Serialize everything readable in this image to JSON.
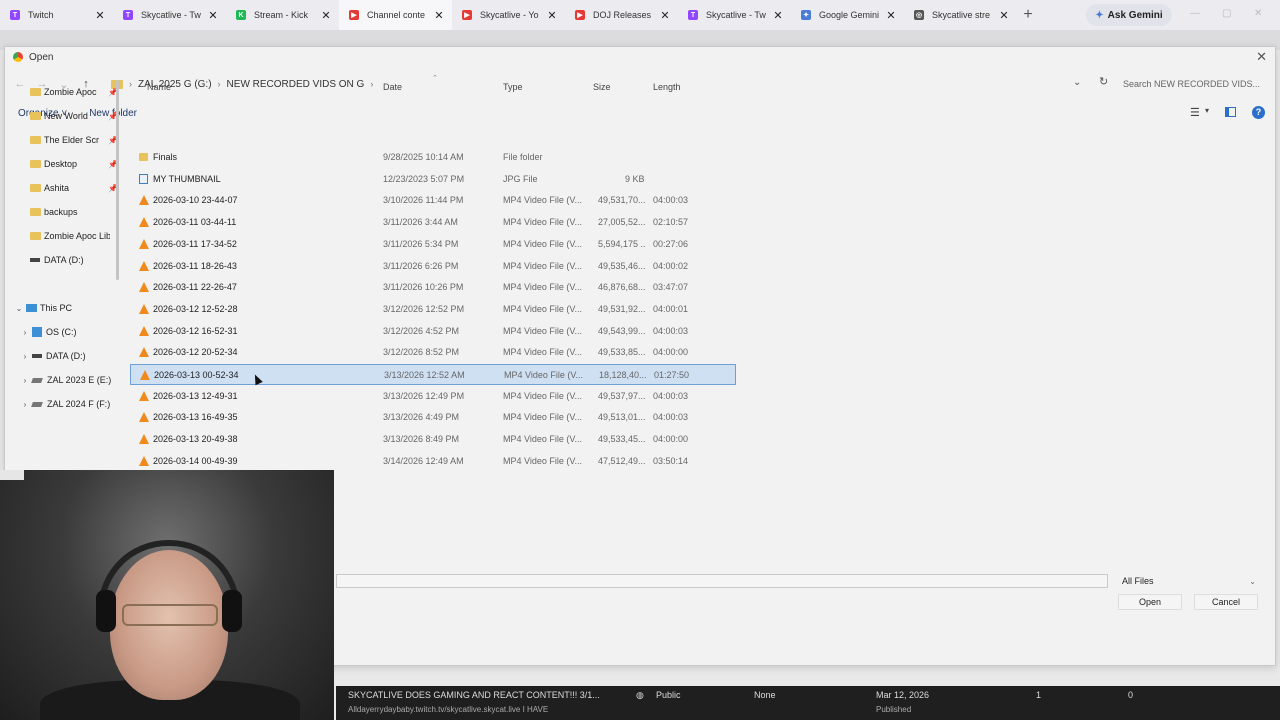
{
  "tabs": [
    {
      "label": "Twitch",
      "color": "#9146ff",
      "glyph": "T"
    },
    {
      "label": "Skycatlive - Tw",
      "color": "#9146ff",
      "glyph": "T"
    },
    {
      "label": "Stream - Kick",
      "color": "#1db954",
      "glyph": "K"
    },
    {
      "label": "Channel conte",
      "color": "#e53935",
      "glyph": "▶",
      "active": true
    },
    {
      "label": "Skycatlive - Yo",
      "color": "#e53935",
      "glyph": "▶"
    },
    {
      "label": "DOJ Releases",
      "color": "#e53935",
      "glyph": "▶"
    },
    {
      "label": "Skycatlive - Tw",
      "color": "#9146ff",
      "glyph": "T"
    },
    {
      "label": "Google Gemini",
      "color": "#4a7bd6",
      "glyph": "✦"
    },
    {
      "label": "Skycatlive stre",
      "color": "#555555",
      "glyph": "◎"
    }
  ],
  "ask_gemini": "Ask Gemini",
  "dialog": {
    "title": "Open",
    "breadcrumb": [
      "ZAL 2025 G (G:)",
      "NEW RECORDED VIDS ON G"
    ],
    "search_placeholder": "Search NEW RECORDED VIDS...",
    "organize": "Organize",
    "new_folder": "New folder",
    "columns": {
      "name": "Name",
      "date": "Date",
      "type": "Type",
      "size": "Size",
      "length": "Length"
    },
    "file_type": "All Files",
    "open": "Open",
    "cancel": "Cancel"
  },
  "nav": [
    {
      "label": "Zombie Apoc",
      "kind": "folder",
      "pin": true
    },
    {
      "label": "New World",
      "kind": "folder",
      "pin": true
    },
    {
      "label": "The Elder Scr",
      "kind": "folder",
      "pin": true
    },
    {
      "label": "Desktop",
      "kind": "folder",
      "pin": true
    },
    {
      "label": "Ashita",
      "kind": "folder",
      "pin": true
    },
    {
      "label": "backups",
      "kind": "folder"
    },
    {
      "label": "Zombie Apoc Lib",
      "kind": "folder"
    },
    {
      "label": "DATA (D:)",
      "kind": "drive"
    },
    {
      "label": "",
      "kind": "spacer"
    },
    {
      "label": "This PC",
      "kind": "pc",
      "exp": "⌄"
    },
    {
      "label": "OS (C:)",
      "kind": "win",
      "exp": "›"
    },
    {
      "label": "DATA (D:)",
      "kind": "drive",
      "exp": "›"
    },
    {
      "label": "ZAL 2023 E (E:)",
      "kind": "disk",
      "exp": "›"
    },
    {
      "label": "ZAL 2024 F (F:)",
      "kind": "disk",
      "exp": "›"
    }
  ],
  "files": [
    {
      "name": "Finals",
      "icon": "folder",
      "date": "9/28/2025 10:14 AM",
      "type": "File folder",
      "size": "",
      "length": ""
    },
    {
      "name": "MY THUMBNAIL",
      "icon": "jpg",
      "date": "12/23/2023 5:07 PM",
      "type": "JPG File",
      "size": "9 KB",
      "length": ""
    },
    {
      "name": "2026-03-10 23-44-07",
      "icon": "vlc",
      "date": "3/10/2026 11:44 PM",
      "type": "MP4 Video File (V...",
      "size": "49,531,70...",
      "length": "04:00:03"
    },
    {
      "name": "2026-03-11 03-44-11",
      "icon": "vlc",
      "date": "3/11/2026 3:44 AM",
      "type": "MP4 Video File (V...",
      "size": "27,005,52...",
      "length": "02:10:57"
    },
    {
      "name": "2026-03-11 17-34-52",
      "icon": "vlc",
      "date": "3/11/2026 5:34 PM",
      "type": "MP4 Video File (V...",
      "size": "5,594,175 ...",
      "length": "00:27:06"
    },
    {
      "name": "2026-03-11 18-26-43",
      "icon": "vlc",
      "date": "3/11/2026 6:26 PM",
      "type": "MP4 Video File (V...",
      "size": "49,535,46...",
      "length": "04:00:02"
    },
    {
      "name": "2026-03-11 22-26-47",
      "icon": "vlc",
      "date": "3/11/2026 10:26 PM",
      "type": "MP4 Video File (V...",
      "size": "46,876,68...",
      "length": "03:47:07"
    },
    {
      "name": "2026-03-12 12-52-28",
      "icon": "vlc",
      "date": "3/12/2026 12:52 PM",
      "type": "MP4 Video File (V...",
      "size": "49,531,92...",
      "length": "04:00:01"
    },
    {
      "name": "2026-03-12 16-52-31",
      "icon": "vlc",
      "date": "3/12/2026 4:52 PM",
      "type": "MP4 Video File (V...",
      "size": "49,543,99...",
      "length": "04:00:03"
    },
    {
      "name": "2026-03-12 20-52-34",
      "icon": "vlc",
      "date": "3/12/2026 8:52 PM",
      "type": "MP4 Video File (V...",
      "size": "49,533,85...",
      "length": "04:00:00"
    },
    {
      "name": "2026-03-13 00-52-34",
      "icon": "vlc",
      "date": "3/13/2026 12:52 AM",
      "type": "MP4 Video File (V...",
      "size": "18,128,40...",
      "length": "01:27:50",
      "selected": true
    },
    {
      "name": "2026-03-13 12-49-31",
      "icon": "vlc",
      "date": "3/13/2026 12:49 PM",
      "type": "MP4 Video File (V...",
      "size": "49,537,97...",
      "length": "04:00:03"
    },
    {
      "name": "2026-03-13 16-49-35",
      "icon": "vlc",
      "date": "3/13/2026 4:49 PM",
      "type": "MP4 Video File (V...",
      "size": "49,513,01...",
      "length": "04:00:03"
    },
    {
      "name": "2026-03-13 20-49-38",
      "icon": "vlc",
      "date": "3/13/2026 8:49 PM",
      "type": "MP4 Video File (V...",
      "size": "49,533,45...",
      "length": "04:00:00"
    },
    {
      "name": "2026-03-14 00-49-39",
      "icon": "vlc",
      "date": "3/14/2026 12:49 AM",
      "type": "MP4 Video File (V...",
      "size": "47,512,49...",
      "length": "03:50:14"
    }
  ],
  "background_row": {
    "title": "SKYCATLIVE DOES GAMING AND REACT CONTENT!!! 3/1...",
    "subtitle": "Alldayerrydaybaby.twitch.tv/skycatlive.skycat.live I HAVE",
    "visibility": "Public",
    "restrictions": "None",
    "date": "Mar 12, 2026",
    "status": "Published",
    "views": "1",
    "comments": "0"
  }
}
